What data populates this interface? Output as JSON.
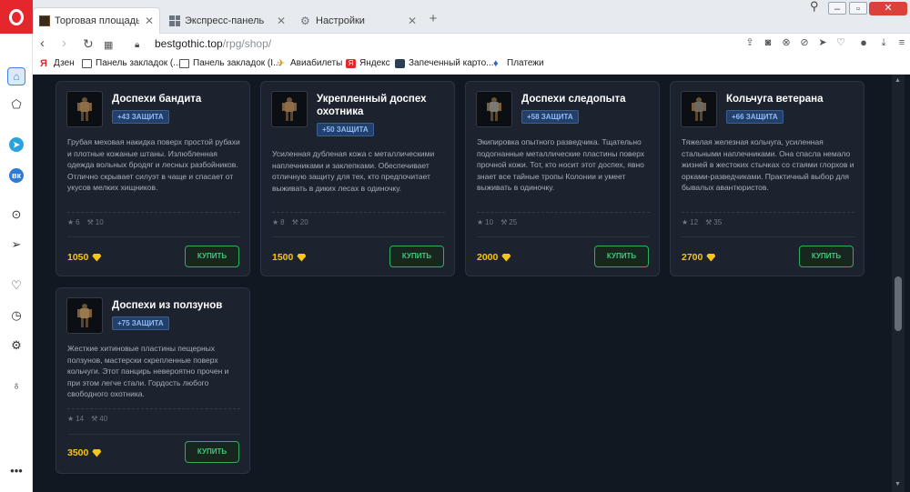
{
  "browser": {
    "tabs": [
      {
        "title": "Торговая площадь - Best G",
        "active": true
      },
      {
        "title": "Экспресс-панель",
        "active": false
      },
      {
        "title": "Настройки",
        "active": false
      }
    ],
    "url_domain": "bestgothic.top",
    "url_path": "/rpg/shop/",
    "bookmarks": [
      {
        "label": "Дзен",
        "icon": "yandex-icon"
      },
      {
        "label": "Панель закладок (...",
        "icon": "folder-icon"
      },
      {
        "label": "Панель закладок (I...",
        "icon": "folder-icon"
      },
      {
        "label": "Авиабилеты",
        "icon": "plane-icon"
      },
      {
        "label": "Яндекс",
        "icon": "yandex-icon"
      },
      {
        "label": "Запеченный карто...",
        "icon": "recipe-icon"
      },
      {
        "label": "Платежи",
        "icon": "payment-icon"
      }
    ]
  },
  "shop": {
    "buy_label": "КУПИТЬ",
    "currency_icon": "gem-icon",
    "items": [
      {
        "title": "Доспехи бандита",
        "badge": "+43 ЗАЩИТА",
        "description": "Грубая меховая накидка поверх простой рубахи и плотные кожаные штаны. Излюбленная одежда вольных бродяг и лесных разбойников. Отлично скрывает силуэт в чаще и спасает от укусов мелких хищников.",
        "stat_level": "6",
        "stat_strength": "10",
        "price": "1050"
      },
      {
        "title": "Укрепленный доспех охотника",
        "badge": "+50 ЗАЩИТА",
        "description": "Усиленная дубленая кожа с металлическими наплечниками и заклепками. Обеспечивает отличную защиту для тех, кто предпочитает выживать в диких лесах в одиночку.",
        "stat_level": "8",
        "stat_strength": "20",
        "price": "1500"
      },
      {
        "title": "Доспехи следопыта",
        "badge": "+58 ЗАЩИТА",
        "description": "Экипировка опытного разведчика. Тщательно подогнанные металлические пластины поверх прочной кожи. Тот, кто носит этот доспех, явно знает все тайные тропы Колонии и умеет выживать в одиночку.",
        "stat_level": "10",
        "stat_strength": "25",
        "price": "2000"
      },
      {
        "title": "Кольчуга ветерана",
        "badge": "+66 ЗАЩИТА",
        "description": "Тяжелая железная кольчуга, усиленная стальными наплечниками. Она спасла немало жизней в жестоких стычках со стаями глорхов и орками-разведчиками. Практичный выбор для бывалых авантюристов.",
        "stat_level": "12",
        "stat_strength": "35",
        "price": "2700"
      },
      {
        "title": "Доспехи из ползунов",
        "badge": "+75 ЗАЩИТА",
        "description": "Жесткие хитиновые пластины пещерных ползунов, мастерски скрепленные поверх кольчуги. Этот панцирь невероятно прочен и при этом легче стали. Гордость любого свободного охотника.",
        "stat_level": "14",
        "stat_strength": "40",
        "price": "3500"
      }
    ]
  }
}
